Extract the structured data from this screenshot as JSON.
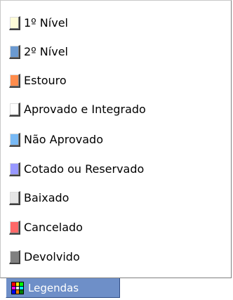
{
  "legend": {
    "items": [
      {
        "label": "1º Nível",
        "color": "#fffcd8"
      },
      {
        "label": "2º Nível",
        "color": "#6b9ad1"
      },
      {
        "label": "Estouro",
        "color": "#ff8c4c"
      },
      {
        "label": "Aprovado e Integrado",
        "color": "#ffffff"
      },
      {
        "label": "Não Aprovado",
        "color": "#78b9f5"
      },
      {
        "label": "Cotado ou Reservado",
        "color": "#9898ff"
      },
      {
        "label": "Baixado",
        "color": "#e6e6e6"
      },
      {
        "label": "Cancelado",
        "color": "#ff6868"
      },
      {
        "label": "Devolvido",
        "color": "#808080"
      }
    ]
  },
  "tab": {
    "label": "Legendas",
    "icon": "color-grid-icon"
  }
}
